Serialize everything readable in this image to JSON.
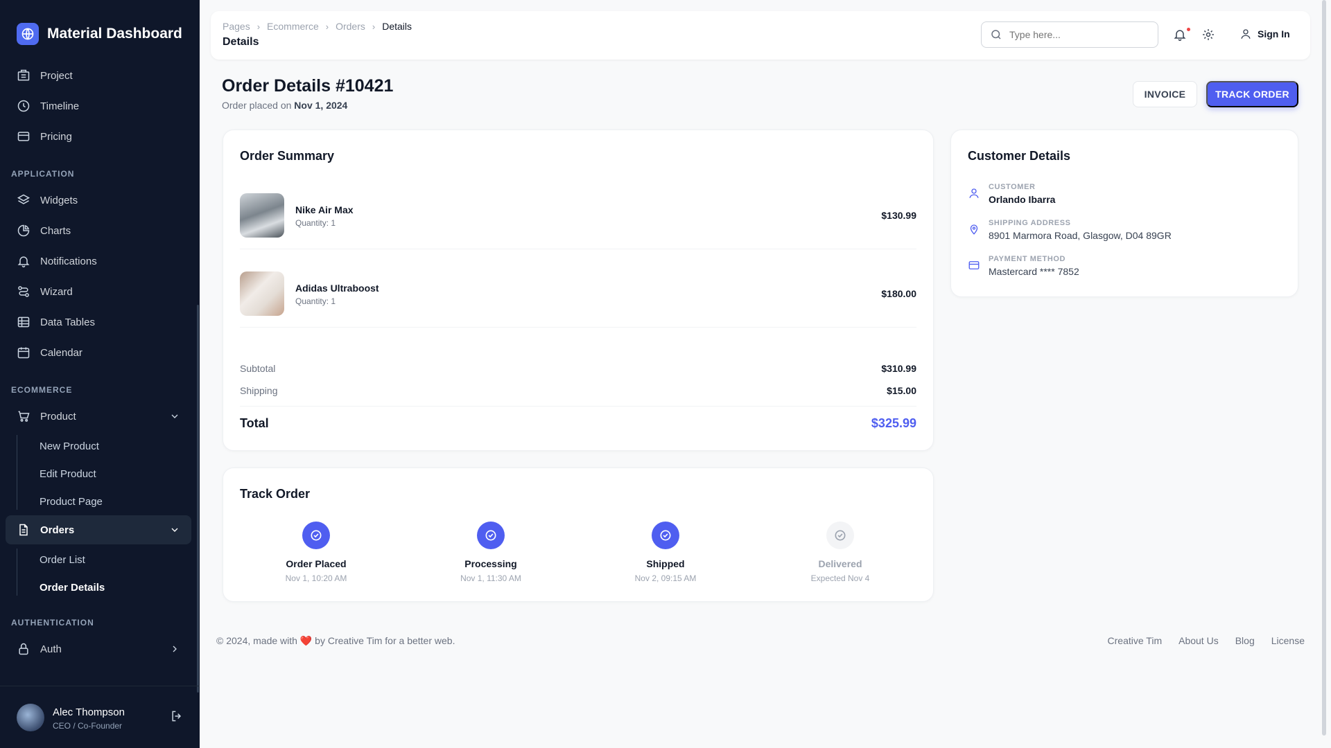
{
  "brand": {
    "title": "Material Dashboard",
    "logo_icon": "globe-icon",
    "accent": "#4f6bf0"
  },
  "nav": {
    "top_items": [
      {
        "label": "Project",
        "icon": "building-icon"
      },
      {
        "label": "Timeline",
        "icon": "clock-icon"
      },
      {
        "label": "Pricing",
        "icon": "card-icon"
      }
    ],
    "application_label": "APPLICATION",
    "application_items": [
      {
        "label": "Widgets",
        "icon": "layers-icon"
      },
      {
        "label": "Charts",
        "icon": "pie-chart-icon"
      },
      {
        "label": "Notifications",
        "icon": "bell-icon"
      },
      {
        "label": "Wizard",
        "icon": "route-icon"
      },
      {
        "label": "Data Tables",
        "icon": "table-icon"
      },
      {
        "label": "Calendar",
        "icon": "calendar-icon"
      }
    ],
    "ecommerce_label": "ECOMMERCE",
    "product": {
      "label": "Product",
      "sub": [
        "New Product",
        "Edit Product",
        "Product Page"
      ]
    },
    "orders": {
      "label": "Orders",
      "sub": [
        "Order List",
        "Order Details"
      ]
    },
    "authentication_label": "AUTHENTICATION",
    "auth": {
      "label": "Auth"
    }
  },
  "user": {
    "name": "Alec Thompson",
    "role": "CEO / Co-Founder"
  },
  "topbar": {
    "breadcrumbs": [
      "Pages",
      "Ecommerce",
      "Orders",
      "Details"
    ],
    "page_title": "Details",
    "search_placeholder": "Type here...",
    "sign_in": "Sign In"
  },
  "order": {
    "title": "Order Details #10421",
    "placed_prefix": "Order placed on",
    "placed_date": "Nov 1, 2024",
    "invoice_label": "INVOICE",
    "track_label": "TRACK ORDER"
  },
  "summary": {
    "title": "Order Summary",
    "items": [
      {
        "name": "Nike Air Max",
        "qty": "Quantity: 1",
        "price": "$130.99"
      },
      {
        "name": "Adidas Ultraboost",
        "qty": "Quantity: 1",
        "price": "$180.00"
      }
    ],
    "subtotal_label": "Subtotal",
    "subtotal": "$310.99",
    "shipping_label": "Shipping",
    "shipping": "$15.00",
    "total_label": "Total",
    "total": "$325.99",
    "total_color": "#4f5ef0"
  },
  "customer": {
    "title": "Customer Details",
    "rows": [
      {
        "key": "CUSTOMER",
        "value": "Orlando Ibarra",
        "icon": "user-icon"
      },
      {
        "key": "SHIPPING ADDRESS",
        "value": "8901 Marmora Road, Glasgow, D04 89GR",
        "icon": "map-pin-icon"
      },
      {
        "key": "PAYMENT METHOD",
        "value": "Mastercard **** 7852",
        "icon": "credit-card-icon"
      }
    ]
  },
  "tracking": {
    "title": "Track Order",
    "steps": [
      {
        "name": "Order Placed",
        "time": "Nov 1, 10:20 AM",
        "done": true
      },
      {
        "name": "Processing",
        "time": "Nov 1, 11:30 AM",
        "done": true
      },
      {
        "name": "Shipped",
        "time": "Nov 2, 09:15 AM",
        "done": true
      },
      {
        "name": "Delivered",
        "time": "Expected Nov 4",
        "done": false
      }
    ]
  },
  "footer": {
    "copy_before": "© 2024, made with",
    "copy_after": "by Creative Tim for a better web.",
    "links": [
      "Creative Tim",
      "About Us",
      "Blog",
      "License"
    ]
  }
}
